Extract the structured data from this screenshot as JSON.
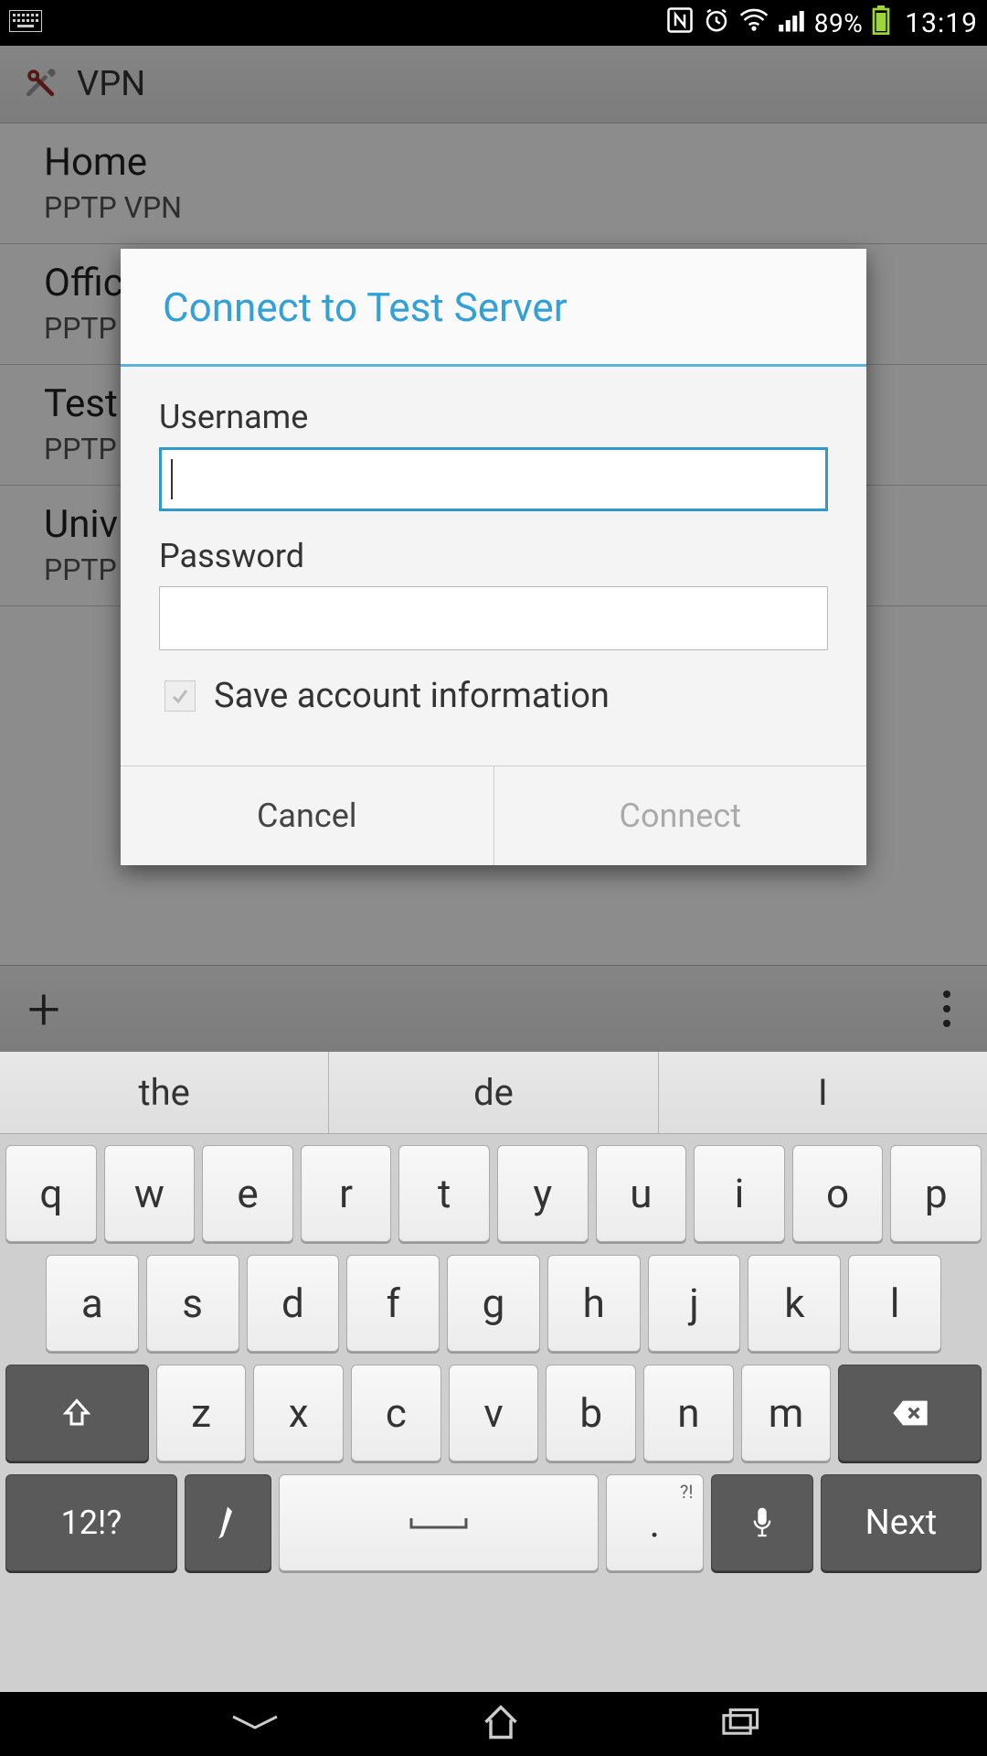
{
  "status": {
    "battery": "89%",
    "time": "13:19"
  },
  "actionbar": {
    "title": "VPN"
  },
  "vpn_list": [
    {
      "title": "Home",
      "subtitle": "PPTP VPN"
    },
    {
      "title": "Offic",
      "subtitle": "PPTP"
    },
    {
      "title": "Test",
      "subtitle": "PPTP"
    },
    {
      "title": "Univ",
      "subtitle": "PPTP"
    }
  ],
  "dialog": {
    "title": "Connect to Test Server",
    "username_label": "Username",
    "username_value": "",
    "password_label": "Password",
    "password_value": "",
    "save_label": "Save account information",
    "save_checked": false,
    "cancel": "Cancel",
    "connect": "Connect"
  },
  "keyboard": {
    "suggestions": [
      "the",
      "de",
      "I"
    ],
    "rows": [
      [
        "q",
        "w",
        "e",
        "r",
        "t",
        "y",
        "u",
        "i",
        "o",
        "p"
      ],
      [
        "a",
        "s",
        "d",
        "f",
        "g",
        "h",
        "j",
        "k",
        "l"
      ],
      [
        "z",
        "x",
        "c",
        "v",
        "b",
        "n",
        "m"
      ]
    ],
    "sym": "12!?",
    "dot": ".",
    "dot_hint": "?!",
    "next": "Next"
  }
}
